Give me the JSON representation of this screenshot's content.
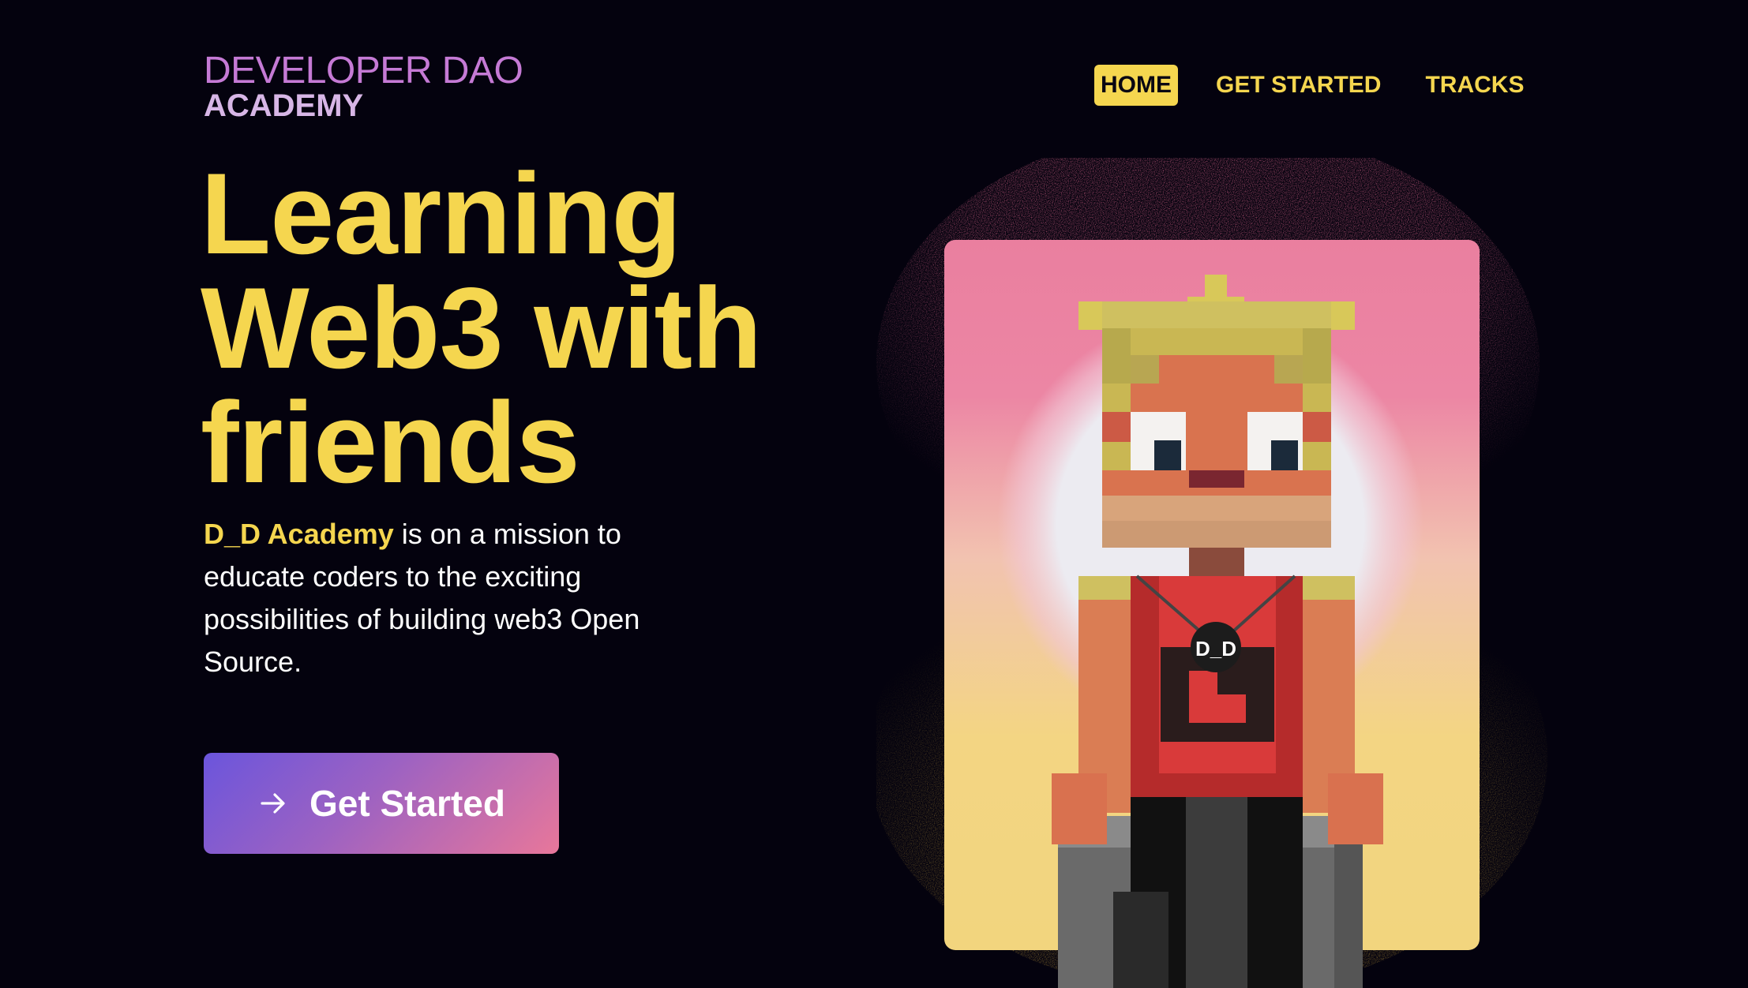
{
  "brand": {
    "logo_top": "DEVELOPER DAO",
    "logo_bottom": "ACADEMY"
  },
  "nav": {
    "items": [
      {
        "label": "HOME",
        "active": true
      },
      {
        "label": "GET STARTED",
        "active": false
      },
      {
        "label": "TRACKS",
        "active": false
      }
    ]
  },
  "hero": {
    "title_line1": "Learning",
    "title_line2": "Web3 with",
    "title_line3": "friends",
    "desc_brand": "D_D Academy",
    "desc_text": " is on a mission to educate coders to the exciting possibilities of building web3 Open Source.",
    "cta_label": "Get Started",
    "cta_icon": "arrow-right-icon"
  },
  "illustration": {
    "badge_text": "D_D"
  },
  "colors": {
    "background": "#04020e",
    "accent_yellow": "#f5d64f",
    "logo_purple": "#c57ad5",
    "logo_lilac": "#d7b6e6",
    "cta_gradient_start": "#6b55dc",
    "cta_gradient_end": "#e8779a"
  }
}
